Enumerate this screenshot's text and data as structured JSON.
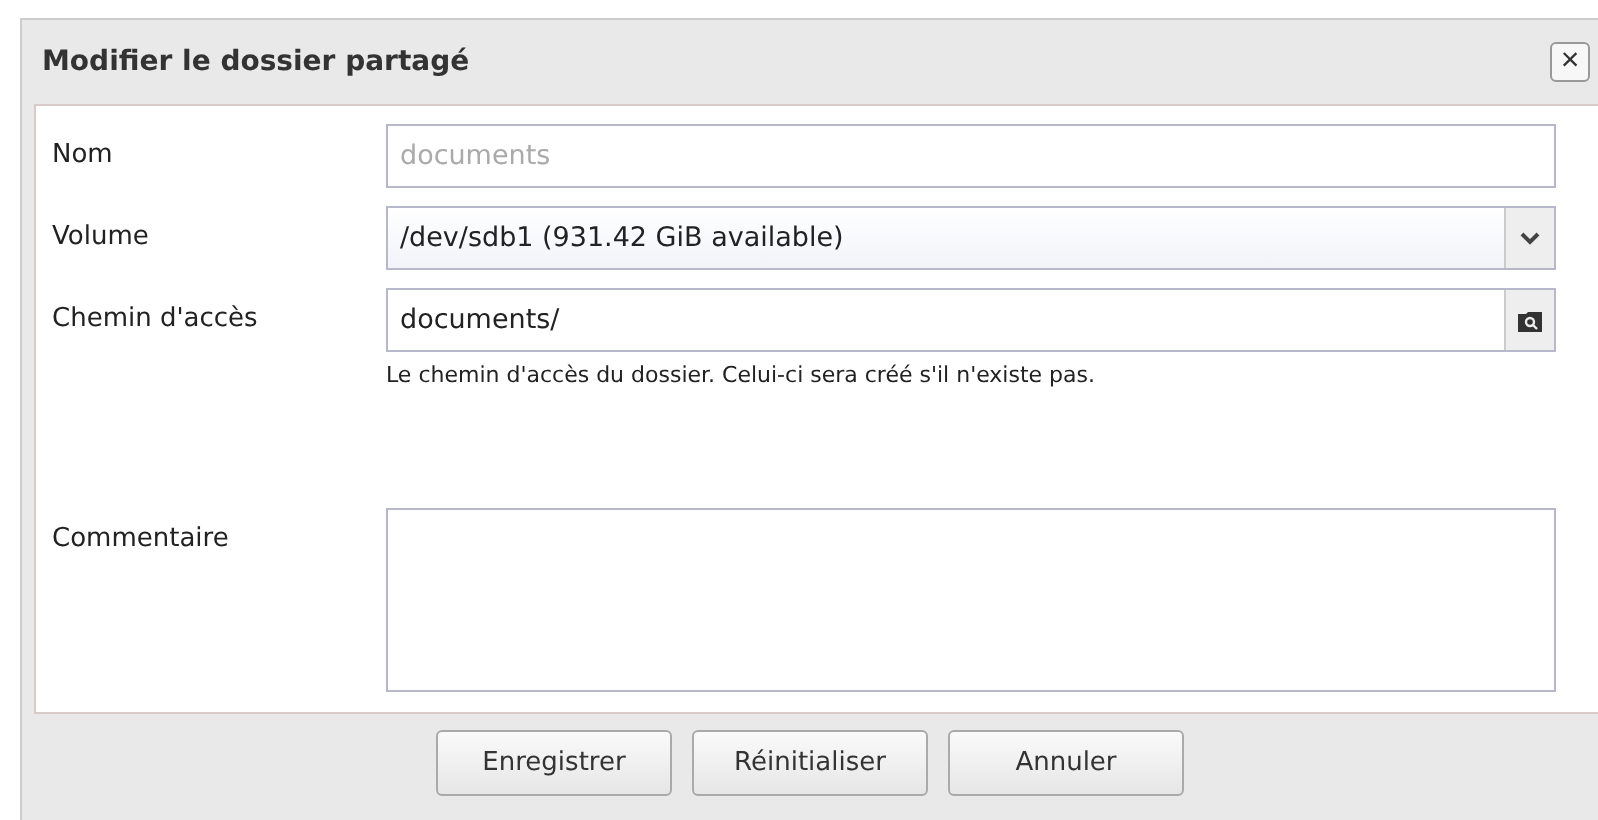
{
  "window": {
    "title": "Modifier le dossier partagé",
    "close": "×"
  },
  "fields": [
    {
      "kind": "text",
      "label": "Nom",
      "value": "documents",
      "disabled": true
    },
    {
      "kind": "select",
      "label": "Volume",
      "value": "/dev/sdb1 (931.42 GiB available)",
      "disabled": false
    },
    {
      "kind": "path",
      "label": "Chemin d'accès",
      "value": "documents/",
      "disabled": false,
      "help": "Le chemin d'accès du dossier. Celui-ci sera créé s'il n'existe pas."
    },
    {
      "kind": "textarea",
      "label": "Commentaire",
      "disabled": false
    }
  ],
  "buttons": [
    "Enregistrer",
    "Réinitialiser",
    "Annuler"
  ]
}
